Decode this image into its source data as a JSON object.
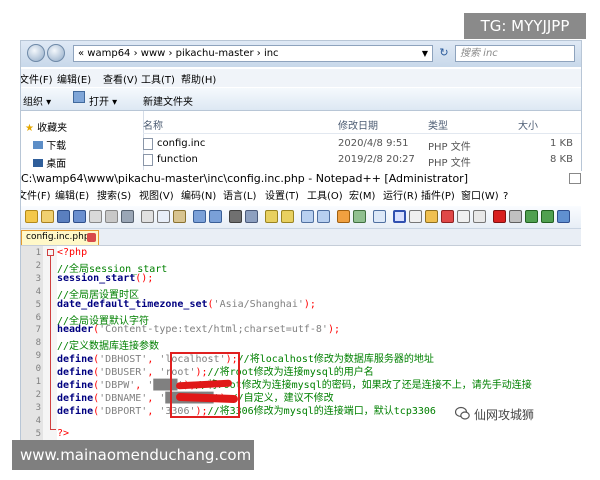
{
  "explorer": {
    "address_path": "« wamp64 › www › pikachu-master › inc",
    "search_placeholder": "搜索 inc",
    "menu": [
      "文件(F)",
      "编辑(E)",
      "查看(V)",
      "工具(T)",
      "帮助(H)"
    ],
    "toolbar": {
      "organize": "组织 ▾",
      "open": "打开 ▾",
      "new_folder": "新建文件夹"
    },
    "nav": [
      {
        "label": "收藏夹",
        "icon": "star-icon"
      },
      {
        "label": "下载",
        "icon": "download-folder-icon"
      },
      {
        "label": "桌面",
        "icon": "desktop-icon"
      }
    ],
    "columns": [
      "名称",
      "修改日期",
      "类型",
      "大小"
    ],
    "files": [
      {
        "name": "config.inc",
        "date": "2020/4/8 9:51",
        "type": "PHP 文件",
        "size": "1 KB"
      },
      {
        "name": "function",
        "date": "2019/2/8 20:27",
        "type": "PHP 文件",
        "size": "8 KB"
      }
    ]
  },
  "notepad": {
    "title": "C:\\wamp64\\www\\pikachu-master\\inc\\config.inc.php - Notepad++ [Administrator]",
    "menu": [
      "文件(F)",
      "编辑(E)",
      "搜索(S)",
      "视图(V)",
      "编码(N)",
      "语言(L)",
      "设置(T)",
      "工具(O)",
      "宏(M)",
      "运行(R)",
      "插件(P)",
      "窗口(W)",
      "?"
    ],
    "tab_label": "config.inc.php",
    "code_lines": [
      {
        "n": "1",
        "parts": [
          [
            "tg",
            "<?php"
          ]
        ]
      },
      {
        "n": "2",
        "parts": [
          [
            "cm",
            "//全局session_start"
          ]
        ]
      },
      {
        "n": "3",
        "parts": [
          [
            "kw",
            "session_start"
          ],
          [
            "op",
            "();"
          ]
        ]
      },
      {
        "n": "4",
        "parts": [
          [
            "cm",
            "//全局居设置时区"
          ]
        ]
      },
      {
        "n": "5",
        "parts": [
          [
            "kw",
            "date_default_timezone_set"
          ],
          [
            "op",
            "("
          ],
          [
            "st",
            "'Asia/Shanghai'"
          ],
          [
            "op",
            ");"
          ]
        ]
      },
      {
        "n": "6",
        "parts": [
          [
            "cm",
            "//全局设置默认字符"
          ]
        ]
      },
      {
        "n": "7",
        "parts": [
          [
            "kw",
            "header"
          ],
          [
            "op",
            "("
          ],
          [
            "st",
            "'Content-type:text/html;charset=utf-8'"
          ],
          [
            "op",
            ");"
          ]
        ]
      },
      {
        "n": "8",
        "parts": [
          [
            "cm",
            "//定义数据库连接参数"
          ]
        ]
      },
      {
        "n": "9",
        "parts": [
          [
            "kw",
            "define"
          ],
          [
            "op",
            "("
          ],
          [
            "st",
            "'DBHOST'"
          ],
          [
            "op",
            ", "
          ],
          [
            "st",
            "'localhost'"
          ],
          [
            "op",
            ");"
          ],
          [
            "cm",
            "//将localhost修改为数据库服务器的地址"
          ]
        ]
      },
      {
        "n": "0",
        "parts": [
          [
            "kw",
            "define"
          ],
          [
            "op",
            "("
          ],
          [
            "st",
            "'DBUSER'"
          ],
          [
            "op",
            ", "
          ],
          [
            "st",
            "'root'"
          ],
          [
            "op",
            ");"
          ],
          [
            "cm",
            "//将root修改为连接mysql的用户名"
          ]
        ]
      },
      {
        "n": "1",
        "parts": [
          [
            "kw",
            "define"
          ],
          [
            "op",
            "("
          ],
          [
            "st",
            "'DBPW'"
          ],
          [
            "op",
            ", "
          ],
          [
            "st",
            "'████'"
          ],
          [
            "op",
            ");"
          ],
          [
            "cm",
            "//将root修改为连接mysql的密码，如果改了还是连接不上，请先手动连接"
          ]
        ]
      },
      {
        "n": "2",
        "parts": [
          [
            "kw",
            "define"
          ],
          [
            "op",
            "("
          ],
          [
            "st",
            "'DBNAME'"
          ],
          [
            "op",
            ", "
          ],
          [
            "st",
            "'████████'"
          ],
          [
            "op",
            ");"
          ],
          [
            "cm",
            "//自定义，建议不修改"
          ]
        ]
      },
      {
        "n": "3",
        "parts": [
          [
            "kw",
            "define"
          ],
          [
            "op",
            "("
          ],
          [
            "st",
            "'DBPORT'"
          ],
          [
            "op",
            ", "
          ],
          [
            "st",
            "'3306'"
          ],
          [
            "op",
            ");"
          ],
          [
            "cm",
            "//将3306修改为mysql的连接端口，默认tcp3306"
          ]
        ]
      },
      {
        "n": "4",
        "parts": []
      },
      {
        "n": "5",
        "parts": [
          [
            "tg",
            "?>"
          ]
        ]
      }
    ]
  },
  "overlays": {
    "tg_badge": "TG: MYYJJPP",
    "bottom_url": "www.mainaomenduchang.com",
    "watermark": "仙网攻城狮"
  }
}
